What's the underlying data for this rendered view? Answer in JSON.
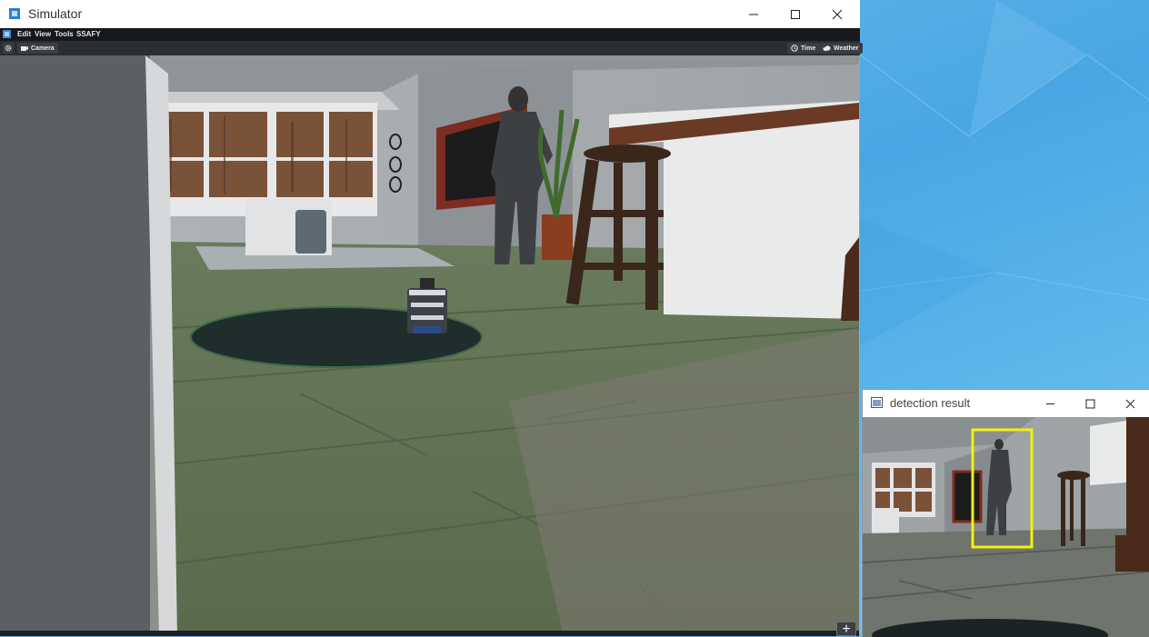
{
  "simulator": {
    "title": "Simulator",
    "menu": [
      "Edit",
      "View",
      "Tools",
      "SSAFY"
    ],
    "toolbar": {
      "camera_label": "Camera",
      "time_label": "Time",
      "weather_label": "Weather"
    },
    "icons": {
      "app": "simulator-app-icon",
      "settings": "gear-icon",
      "camera": "camera-icon",
      "time": "clock-icon",
      "weather": "cloud-icon",
      "add": "plus-icon"
    },
    "add_label": "+"
  },
  "detection": {
    "title": "detection result",
    "box_color": "#f2f20a",
    "box_label_color": "yellow"
  },
  "window_controls": {
    "minimize": "minimize-icon",
    "maximize": "maximize-icon",
    "close": "close-icon"
  },
  "colors": {
    "menubar_bg": "#16181c",
    "toolbar_bg": "#2a2d31",
    "desktop_accent": "#4aa6e2"
  }
}
